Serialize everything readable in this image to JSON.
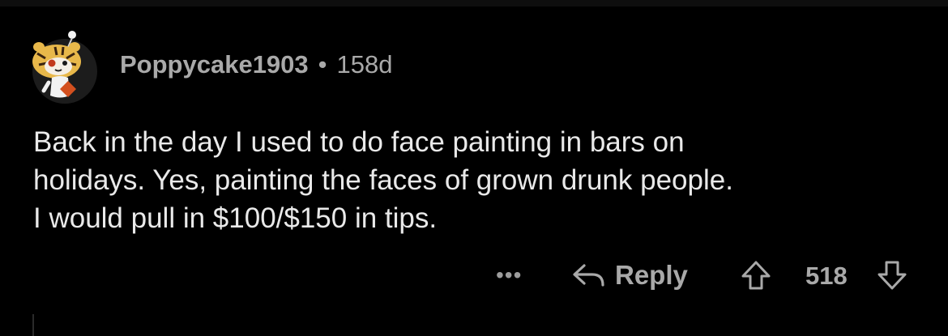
{
  "comment": {
    "author": "Poppycake1903",
    "separator": "•",
    "age": "158d",
    "body_lines": [
      "Back in the day I used to do face painting in bars on",
      "holidays. Yes, painting the faces of grown drunk people.",
      "I would pull in $100/$150 in tips."
    ],
    "avatar_icon": "snoo-tiger-avatar"
  },
  "actions": {
    "more_label": "•••",
    "more_icon": "more-options-icon",
    "reply_label": "Reply",
    "reply_icon": "reply-arrow-icon",
    "upvote_icon": "upvote-arrow-icon",
    "score": "518",
    "downvote_icon": "downvote-arrow-icon"
  },
  "colors": {
    "background": "#000000",
    "body_text": "#e9e9e9",
    "meta_text": "#a9a9a9"
  }
}
